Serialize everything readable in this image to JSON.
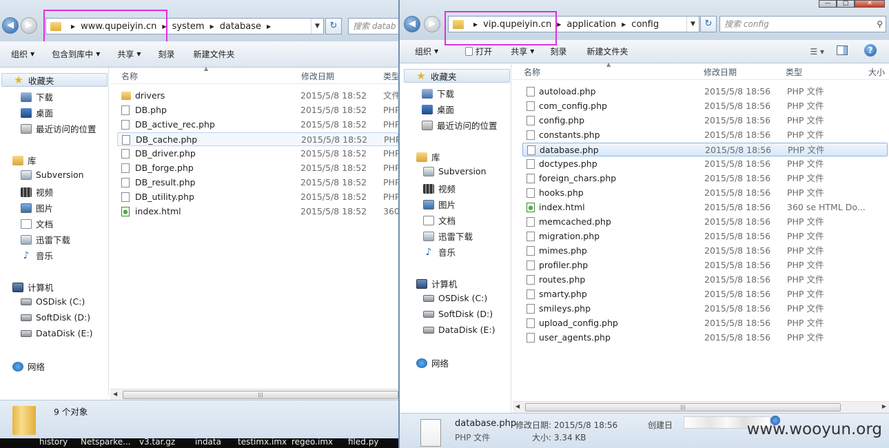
{
  "left": {
    "breadcrumb": [
      "www.qupeiyin.cn",
      "system",
      "database"
    ],
    "search_placeholder": "搜索 datab",
    "toolbar": [
      "组织",
      "包含到库中",
      "共享",
      "刻录",
      "新建文件夹"
    ],
    "columns": [
      "名称",
      "修改日期",
      "类型"
    ],
    "files": [
      {
        "name": "drivers",
        "date": "2015/5/8 18:52",
        "type": "文件",
        "icon": "folder-icon"
      },
      {
        "name": "DB.php",
        "date": "2015/5/8 18:52",
        "type": "PHP",
        "icon": "file-icon"
      },
      {
        "name": "DB_active_rec.php",
        "date": "2015/5/8 18:52",
        "type": "PHP",
        "icon": "file-icon"
      },
      {
        "name": "DB_cache.php",
        "date": "2015/5/8 18:52",
        "type": "PHP",
        "icon": "file-icon"
      },
      {
        "name": "DB_driver.php",
        "date": "2015/5/8 18:52",
        "type": "PHP",
        "icon": "file-icon"
      },
      {
        "name": "DB_forge.php",
        "date": "2015/5/8 18:52",
        "type": "PHP",
        "icon": "file-icon"
      },
      {
        "name": "DB_result.php",
        "date": "2015/5/8 18:52",
        "type": "PHP",
        "icon": "file-icon"
      },
      {
        "name": "DB_utility.php",
        "date": "2015/5/8 18:52",
        "type": "PHP",
        "icon": "file-icon"
      },
      {
        "name": "index.html",
        "date": "2015/5/8 18:52",
        "type": "360",
        "icon": "html-icon"
      }
    ],
    "status_count": "9 个对象"
  },
  "right": {
    "breadcrumb": [
      "vip.qupeiyin.cn",
      "application",
      "config"
    ],
    "search_placeholder": "搜索 config",
    "toolbar": [
      "组织",
      "打开",
      "共享",
      "刻录",
      "新建文件夹"
    ],
    "columns": [
      "名称",
      "修改日期",
      "类型",
      "大小"
    ],
    "files": [
      {
        "name": "autoload.php",
        "date": "2015/5/8 18:56",
        "type": "PHP 文件",
        "icon": "file-icon"
      },
      {
        "name": "com_config.php",
        "date": "2015/5/8 18:56",
        "type": "PHP 文件",
        "icon": "file-icon"
      },
      {
        "name": "config.php",
        "date": "2015/5/8 18:56",
        "type": "PHP 文件",
        "icon": "file-icon"
      },
      {
        "name": "constants.php",
        "date": "2015/5/8 18:56",
        "type": "PHP 文件",
        "icon": "file-icon"
      },
      {
        "name": "database.php",
        "date": "2015/5/8 18:56",
        "type": "PHP 文件",
        "icon": "file-icon"
      },
      {
        "name": "doctypes.php",
        "date": "2015/5/8 18:56",
        "type": "PHP 文件",
        "icon": "file-icon"
      },
      {
        "name": "foreign_chars.php",
        "date": "2015/5/8 18:56",
        "type": "PHP 文件",
        "icon": "file-icon"
      },
      {
        "name": "hooks.php",
        "date": "2015/5/8 18:56",
        "type": "PHP 文件",
        "icon": "file-icon"
      },
      {
        "name": "index.html",
        "date": "2015/5/8 18:56",
        "type": "360 se HTML Do...",
        "icon": "html-icon"
      },
      {
        "name": "memcached.php",
        "date": "2015/5/8 18:56",
        "type": "PHP 文件",
        "icon": "file-icon"
      },
      {
        "name": "migration.php",
        "date": "2015/5/8 18:56",
        "type": "PHP 文件",
        "icon": "file-icon"
      },
      {
        "name": "mimes.php",
        "date": "2015/5/8 18:56",
        "type": "PHP 文件",
        "icon": "file-icon"
      },
      {
        "name": "profiler.php",
        "date": "2015/5/8 18:56",
        "type": "PHP 文件",
        "icon": "file-icon"
      },
      {
        "name": "routes.php",
        "date": "2015/5/8 18:56",
        "type": "PHP 文件",
        "icon": "file-icon"
      },
      {
        "name": "smarty.php",
        "date": "2015/5/8 18:56",
        "type": "PHP 文件",
        "icon": "file-icon"
      },
      {
        "name": "smileys.php",
        "date": "2015/5/8 18:56",
        "type": "PHP 文件",
        "icon": "file-icon"
      },
      {
        "name": "upload_config.php",
        "date": "2015/5/8 18:56",
        "type": "PHP 文件",
        "icon": "file-icon"
      },
      {
        "name": "user_agents.php",
        "date": "2015/5/8 18:56",
        "type": "PHP 文件",
        "icon": "file-icon"
      }
    ],
    "details": {
      "name": "database.php",
      "type": "PHP 文件",
      "modified_label": "修改日期: 2015/5/8 18:56",
      "size_label": "大小: 3.34 KB",
      "created_label": "创建日"
    }
  },
  "sidebar": {
    "favorites": "收藏夹",
    "download": "下载",
    "desktop": "桌面",
    "recent": "最近访问的位置",
    "library": "库",
    "subversion": "Subversion",
    "video": "视频",
    "pictures": "图片",
    "documents": "文档",
    "thunder": "迅雷下载",
    "music": "音乐",
    "computer": "计算机",
    "disk_c": "OSDisk (C:)",
    "disk_d": "SoftDisk (D:)",
    "disk_e": "DataDisk (E:)",
    "network": "网络"
  },
  "taskbar": [
    "history",
    "Netsparke...",
    "v3.tar.gz",
    "indata",
    "testimx.imx",
    "regeo.imx",
    "filed.py"
  ],
  "watermark": "www.wooyun.org",
  "colors": {
    "highlight_box": "#e02ee0",
    "selection": "#d7e8fa"
  }
}
